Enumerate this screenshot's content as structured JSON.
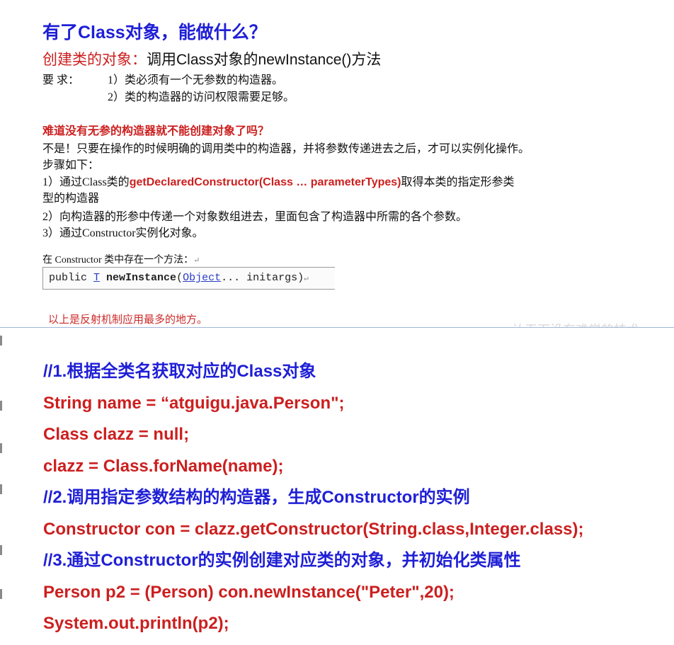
{
  "top_slide": {
    "title": "有了Class对象，能做什么？",
    "subheading_label": "创建类的对象：",
    "subheading_text": "调用Class对象的newInstance()方法",
    "requirements_label": "要  求：",
    "requirements": [
      "1）类必须有一个无参数的构造器。",
      "2）类的构造器的访问权限需要足够。"
    ],
    "question": "难道没有无参的构造器就不能创建对象了吗？",
    "answer_intro": "不是！只要在操作的时候明确的调用类中的构造器，并将参数传递进去之后，才可以实例化操作。",
    "steps_label": "步骤如下：",
    "step1_prefix": "1）通过Class类的",
    "step1_code": "getDeclaredConstructor(Class … parameterTypes)",
    "step1_suffix": "取得本类的指定形参类",
    "step1_cont": "型的构造器",
    "step2": "2）向构造器的形参中传递一个对象数组进去，里面包含了构造器中所需的各个参数。",
    "step3": "3）通过Constructor实例化对象。",
    "snippet_label": "在 Constructor 类中存在一个方法：",
    "snippet_mod": "public ",
    "snippet_type": "T",
    "snippet_method": "newInstance",
    "snippet_paren_open": "(",
    "snippet_param_type": "Object",
    "snippet_rest": "... initargs)",
    "footnote": "以上是反射机制应用最多的地方。"
  },
  "watermark": "让天下没有难学的技术",
  "code_lines": [
    {
      "kind": "comment",
      "text": "//1.根据全类名获取对应的Class对象"
    },
    {
      "kind": "stmt",
      "text": "String name = “atguigu.java.Person\";"
    },
    {
      "kind": "stmt",
      "text": "Class clazz = null;"
    },
    {
      "kind": "stmt",
      "text": "clazz = Class.forName(name);"
    },
    {
      "kind": "comment",
      "text": "//2.调用指定参数结构的构造器，生成Constructor的实例"
    },
    {
      "kind": "stmt",
      "text": "Constructor con = clazz.getConstructor(String.class,Integer.class);"
    },
    {
      "kind": "comment",
      "text": "//3.通过Constructor的实例创建对应类的对象，并初始化类属性"
    },
    {
      "kind": "stmt",
      "text": "Person p2 = (Person) con.newInstance(\"Peter\",20);"
    },
    {
      "kind": "stmt",
      "text": "System.out.println(p2);"
    }
  ],
  "colors": {
    "title_blue": "#1f1fd6",
    "accent_red": "#cc1f1f"
  }
}
